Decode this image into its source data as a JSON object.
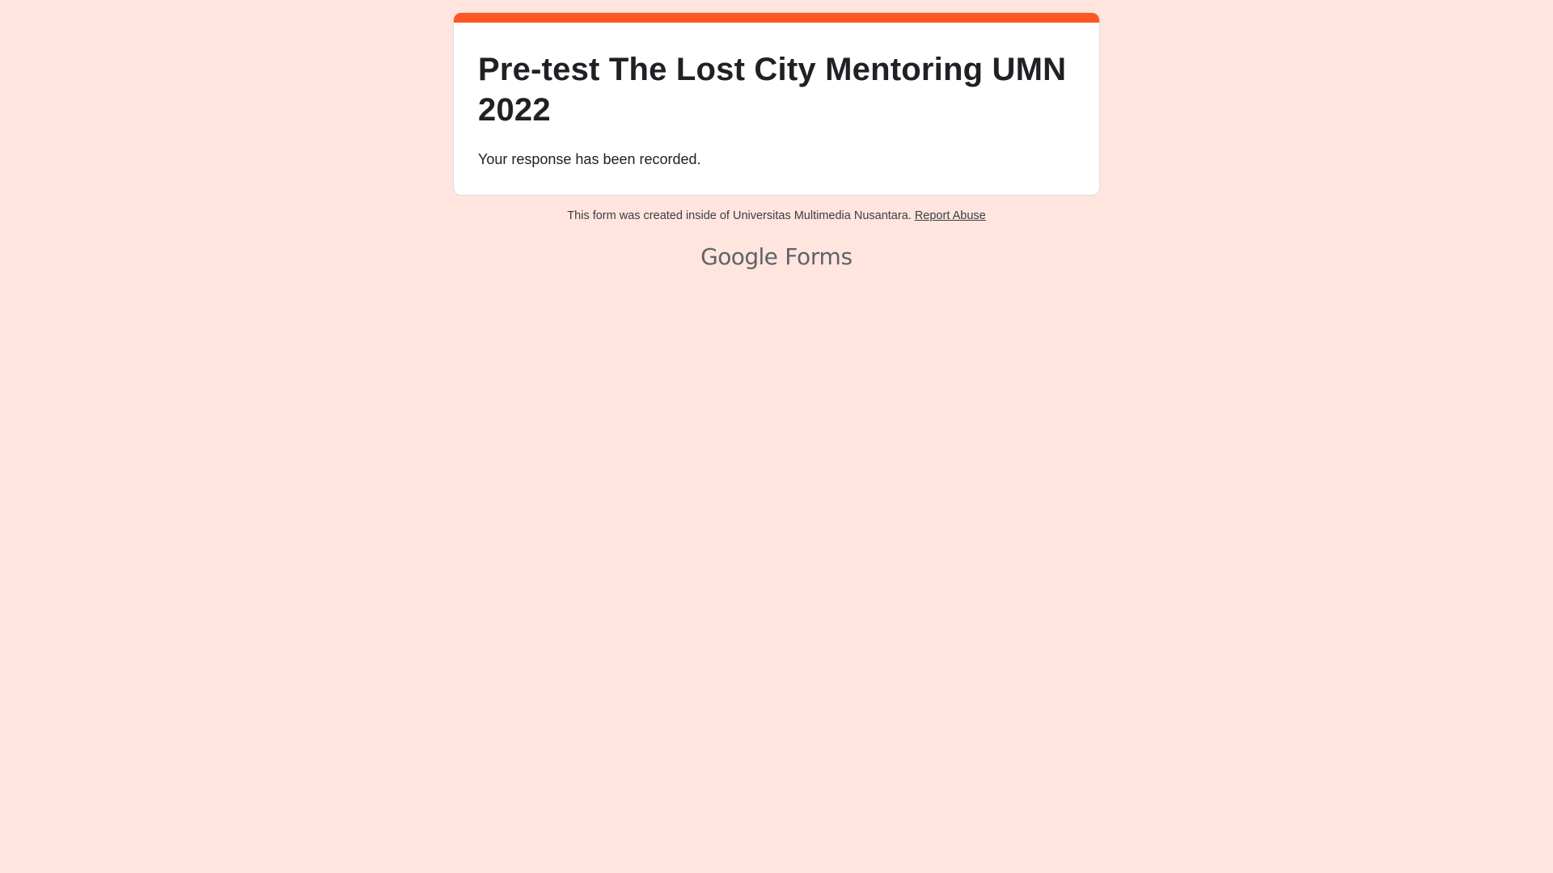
{
  "colors": {
    "background": "#ffe5de",
    "accent": "#ff5722",
    "card": "#ffffff",
    "text": "#202124",
    "muted": "#3c4043"
  },
  "form": {
    "title": "Pre-test The Lost City Mentoring UMN 2022",
    "confirmation": "Your response has been recorded."
  },
  "footer": {
    "note": "This form was created inside of Universitas Multimedia Nusantara.",
    "report_abuse": "Report Abuse"
  },
  "brand": {
    "google": "Google",
    "product": "Forms"
  }
}
